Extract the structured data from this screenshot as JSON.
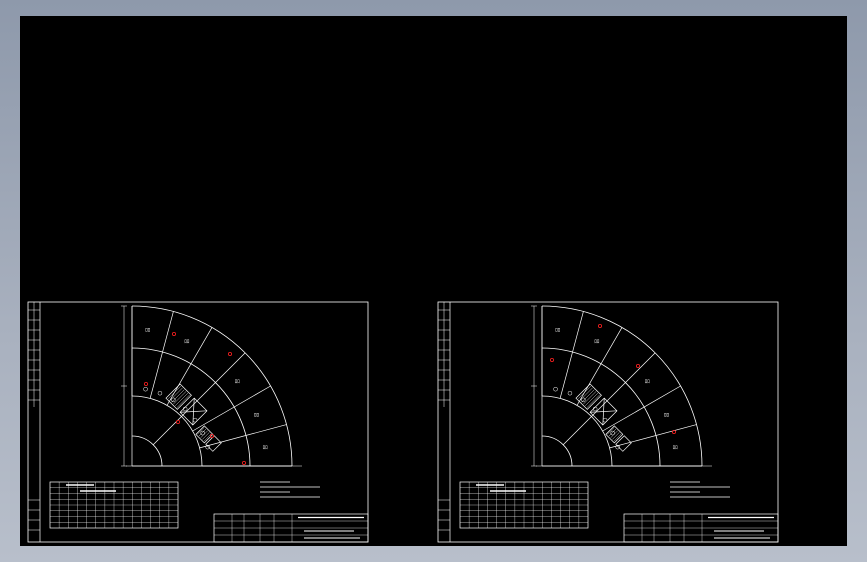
{
  "colors": {
    "frame_bg": "#8e99ab",
    "canvas_bg": "#000000",
    "line": "#ffffff",
    "mark": "#ff2020"
  },
  "drawing": {
    "sheets": [
      {
        "id": "left"
      },
      {
        "id": "right"
      }
    ]
  }
}
